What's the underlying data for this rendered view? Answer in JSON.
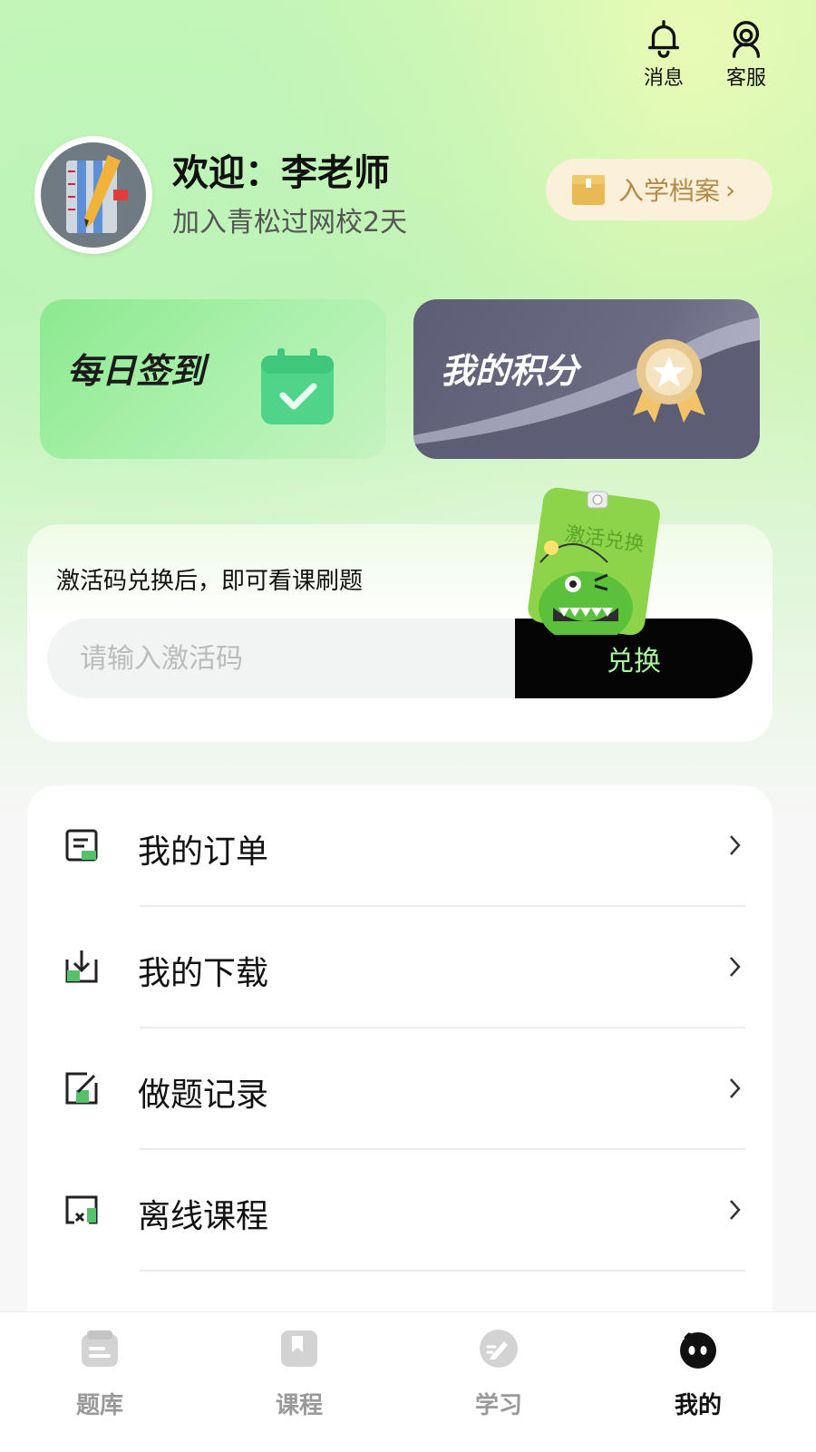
{
  "header": {
    "messages_label": "消息",
    "service_label": "客服"
  },
  "profile": {
    "welcome": "欢迎：李老师",
    "joined": "加入青松过网校2天",
    "archive_label": "入学档案"
  },
  "cards": {
    "sign_in": "每日签到",
    "points": "我的积分"
  },
  "redeem": {
    "hint": "激活码兑换后，即可看课刷题",
    "placeholder": "请输入激活码",
    "button": "兑换",
    "mascot_text": "激活兑换"
  },
  "menu": {
    "items": [
      {
        "label": "我的订单",
        "icon": "order-icon"
      },
      {
        "label": "我的下载",
        "icon": "download-icon"
      },
      {
        "label": "做题记录",
        "icon": "edit-record-icon"
      },
      {
        "label": "离线课程",
        "icon": "offline-course-icon"
      }
    ]
  },
  "tabs": [
    {
      "label": "题库",
      "icon": "question-bank-icon",
      "active": false
    },
    {
      "label": "课程",
      "icon": "course-icon",
      "active": false
    },
    {
      "label": "学习",
      "icon": "study-icon",
      "active": false
    },
    {
      "label": "我的",
      "icon": "mine-icon",
      "active": true
    }
  ],
  "colors": {
    "accent_green": "#a9f59b",
    "archive_text": "#b38a47",
    "points_card": "#5d5d75"
  }
}
